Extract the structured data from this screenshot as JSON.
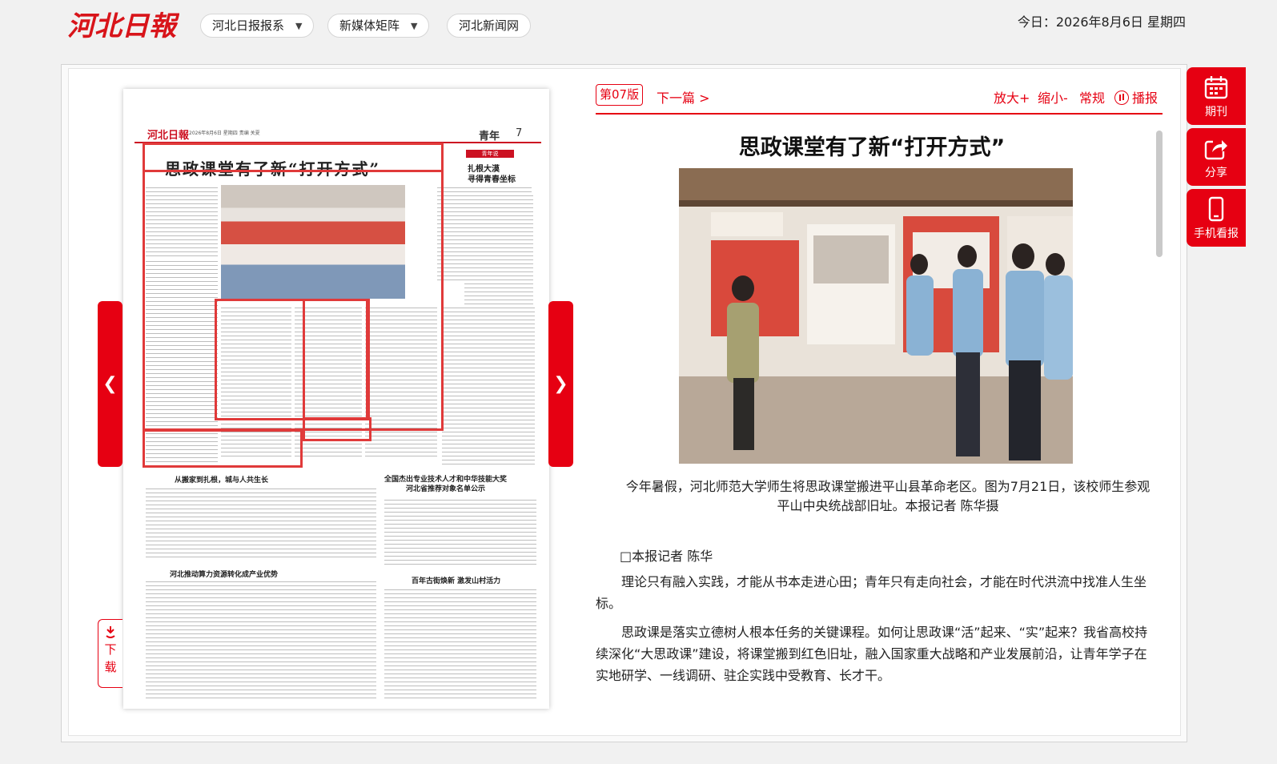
{
  "header": {
    "logo_text": "河北日報",
    "nav": [
      {
        "label": "河北日报报系",
        "has_dropdown": true
      },
      {
        "label": "新媒体矩阵",
        "has_dropdown": true
      },
      {
        "label": "河北新闻网",
        "has_dropdown": false
      }
    ],
    "date": "今日：2026年8月6日 星期四"
  },
  "toolbar": {
    "page_tag": "第07版",
    "next": "下一篇 >",
    "zoom_in": "放大+",
    "zoom_out": "缩小-",
    "normal": "常规",
    "play": "播报"
  },
  "newspaper": {
    "masthead": "河北日報",
    "meta": "2026年8月6日 星期四  责编 关夏",
    "section": "青年",
    "page_num": "7",
    "headline": "思政课堂有了新“打开方式”",
    "column_title": "扎根大漠\n寻得青春坐标",
    "tag": "青年说",
    "story2": "从搬家到扎根，城与人共生长",
    "story3": "全国杰出专业技术人才和中华技能大奖\n河北省推荐对象名单公示",
    "story4": "河北推动算力资源转化成产业优势",
    "story5": "百年古街焕新  激发山村活力"
  },
  "download": "下载",
  "article": {
    "title": "思政课堂有了新“打开方式”",
    "caption": "今年暑假，河北师范大学师生将思政课堂搬进平山县革命老区。图为7月21日，该校师生参观平山中央统战部旧址。本报记者 陈华摄",
    "byline": "□本报记者 陈华",
    "paragraphs": [
      "理论只有融入实践，才能从书本走进心田；青年只有走向社会，才能在时代洪流中找准人生坐标。",
      "思政课是落实立德树人根本任务的关键课程。如何让思政课“活”起来、“实”起来？我省高校持续深化“大思政课”建设，将课堂搬到红色旧址，融入国家重大战略和产业发展前沿，让青年学子在实地研学、一线调研、驻企实践中受教育、长才干。"
    ]
  },
  "sidebar": [
    {
      "label": "期刊",
      "icon": "calendar-icon"
    },
    {
      "label": "分享",
      "icon": "share-icon"
    },
    {
      "label": "手机看报",
      "icon": "phone-icon"
    }
  ],
  "colors": {
    "accent": "#e60012"
  }
}
